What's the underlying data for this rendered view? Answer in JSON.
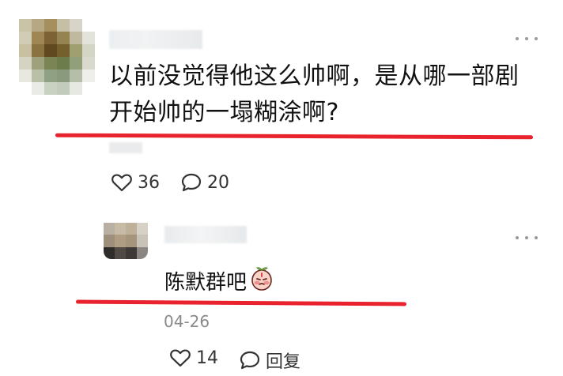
{
  "comment": {
    "text": "以前没觉得他这么帅啊，是从哪一部剧开始帅的一塌糊涂啊?",
    "likes": "36",
    "replies": "20"
  },
  "reply": {
    "text": "陈默群吧",
    "emoji_name": "peach-face-emoji",
    "date": "04-26",
    "likes": "14",
    "reply_label": "回复"
  },
  "colors": {
    "underline": "#e8232d",
    "text": "#111111",
    "muted": "#8a8a8a"
  },
  "icons": [
    "heart-icon",
    "comment-bubble-icon",
    "more-icon"
  ]
}
